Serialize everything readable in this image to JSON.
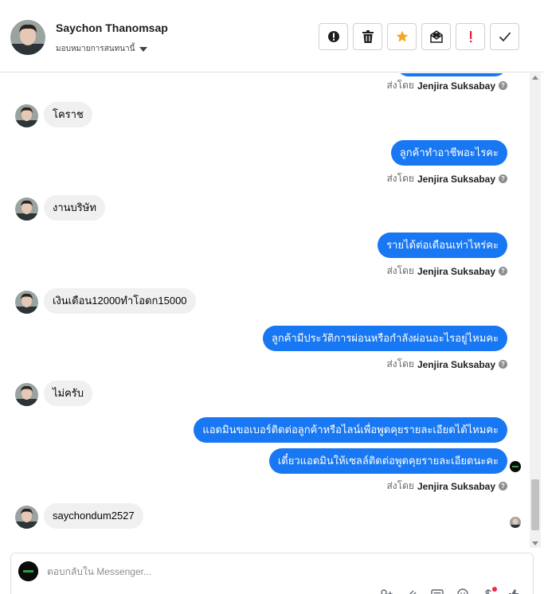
{
  "header": {
    "contact_name": "Saychon Thanomsap",
    "assign_label": "มอบหมายการสนทนานี้"
  },
  "toolbar": [
    {
      "name": "alert-button",
      "icon": "exclamation-circle-icon"
    },
    {
      "name": "delete-button",
      "icon": "trash-icon"
    },
    {
      "name": "star-button",
      "icon": "star-icon",
      "color": "#f5a623"
    },
    {
      "name": "mark-unread-button",
      "icon": "envelope-icon"
    },
    {
      "name": "spam-button",
      "icon": "exclamation-icon",
      "color": "#e41e3f"
    },
    {
      "name": "done-button",
      "icon": "check-icon"
    }
  ],
  "sent_by_prefix": "ส่งโดย",
  "agent_name": "Jenjira Suksabay",
  "messages": [
    {
      "side": "in",
      "text": "โคราช"
    },
    {
      "side": "out",
      "text": "ลูกค้าทำอาชีพอะไรคะ"
    },
    {
      "side": "in",
      "text": "งานบริษัท"
    },
    {
      "side": "out",
      "text": "รายได้ต่อเดือนเท่าไหร่คะ"
    },
    {
      "side": "in",
      "text": "เงินเดือน12000ทำโอดก15000"
    },
    {
      "side": "out",
      "text": "ลูกค้ามีประวัติการผ่อนหรือกำลังผ่อนอะไรอยู่ไหมคะ"
    },
    {
      "side": "in",
      "text": "ไม่ครับ"
    },
    {
      "side": "out",
      "text": "แอดมินขอเบอร์ติดต่อลูกค้าหรือไลน์เพื่อพูดคุยรายละเอียดได้ไหมคะ"
    },
    {
      "side": "out",
      "text": "เดี๋ยวแอดมินให้เซลล์ติดต่อพูดคุยรายละเอียดนะคะ"
    },
    {
      "side": "in",
      "text": "saychondum2527"
    }
  ],
  "composer": {
    "placeholder": "ตอบกลับใน Messenger..."
  },
  "colors": {
    "outgoing_bubble": "#1877f2",
    "incoming_bubble": "#f0f0f0"
  }
}
